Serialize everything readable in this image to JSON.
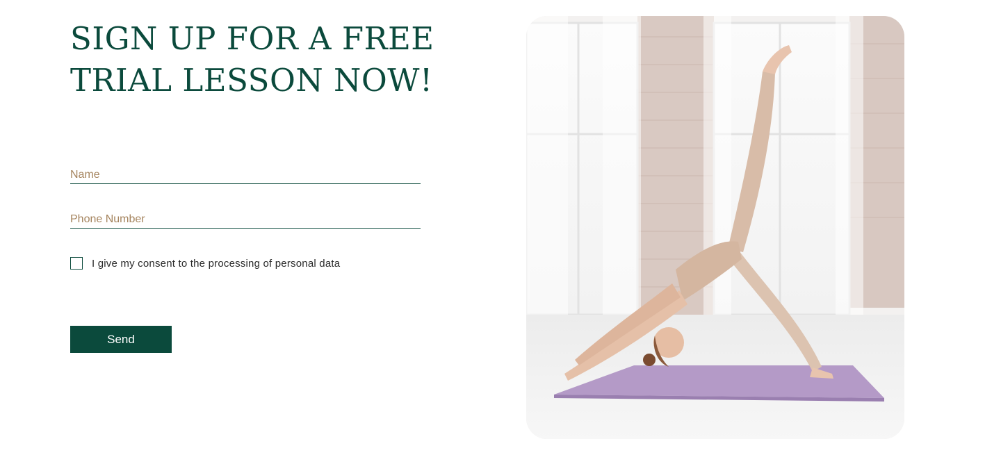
{
  "signup": {
    "title": "SIGN UP FOR A FREE TRIAL LESSON NOW!",
    "name_placeholder": "Name",
    "phone_placeholder": "Phone Number",
    "consent_label": "I give my consent to the processing of personal data",
    "send_label": "Send"
  },
  "photo": {
    "subject": "woman-doing-yoga-three-legged-downward-dog-on-purple-mat"
  },
  "colors": {
    "brand_green": "#0b4a3c",
    "placeholder_tan": "#a5845e",
    "mat_purple": "#b49ac7",
    "outfit_beige": "#dcc3b0"
  }
}
